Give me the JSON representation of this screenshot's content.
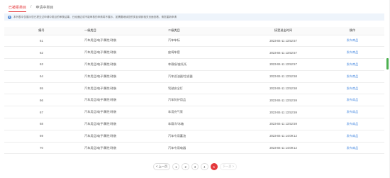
{
  "breadcrumb": {
    "parent": "已被拒类目",
    "separator": "/",
    "current": "申请中类目"
  },
  "notice": {
    "text": "本列表中仅展示您已提交过申请中类目的审核结果，已经通过或不能审核的申请将不展示，如需要继续您的类目请到相关页面查看，请您重新申请"
  },
  "table": {
    "headers": [
      "编号",
      "一级类目",
      "二级类目",
      "接受退出时间",
      "操作"
    ],
    "rows": [
      {
        "id": "61",
        "level1": "汽车用品/电子/属性/改装",
        "level2": "汽车车标",
        "time": "2023-04-11 13:52:57",
        "action": "发布商品"
      },
      {
        "id": "62",
        "level1": "汽车用品/电子/属性/改装",
        "level2": "座椅车套",
        "time": "2023-04-11 13:52:57",
        "action": "发布商品"
      },
      {
        "id": "63",
        "level1": "汽车用品/电子/属性/改装",
        "level2": "车载吸/座托托",
        "time": "2023-04-11 13:52:57",
        "action": "发布商品"
      },
      {
        "id": "64",
        "level1": "汽车用品/电子/属性/改装",
        "level2": "汽车滤油器/空滤器",
        "time": "2023-04-11 13:52:58",
        "action": "发布商品"
      },
      {
        "id": "65",
        "level1": "汽车用品/电子/属性/改装",
        "level2": "驾驶安全灯",
        "time": "2023-04-11 13:52:58",
        "action": "发布商品"
      },
      {
        "id": "66",
        "level1": "汽车用品/电子/属性/改装",
        "level2": "汽车防护用品",
        "time": "2023-04-11 13:52:59",
        "action": "发布商品"
      },
      {
        "id": "67",
        "level1": "汽车用品/电子/属性/改装",
        "level2": "车用充气泵",
        "time": "2023-04-11 13:52:59",
        "action": "发布商品"
      },
      {
        "id": "68",
        "level1": "汽车用品/电子/属性/改装",
        "level2": "车载冷/冰箱",
        "time": "2023-04-11 13:52:59",
        "action": "发布商品"
      },
      {
        "id": "69",
        "level1": "汽车用品/电子/属性/改装",
        "level2": "汽车专用蓄油",
        "time": "2023-04-11 14:09:12",
        "action": "发布商品"
      },
      {
        "id": "70",
        "level1": "汽车用品/电子/属性/改装",
        "level2": "汽车专用电器",
        "time": "2023-04-11 14:09:12",
        "action": "发布商品"
      }
    ]
  },
  "pagination": {
    "prev": "< 上一页",
    "pages": [
      "1",
      "2",
      "3",
      "4",
      "5"
    ],
    "active": "5",
    "next": "下一页 >"
  },
  "colors": {
    "accent": "#e4393c",
    "link": "#4a8be0",
    "notice_bg": "#eef4fb",
    "side_marker": "#4caf50"
  }
}
